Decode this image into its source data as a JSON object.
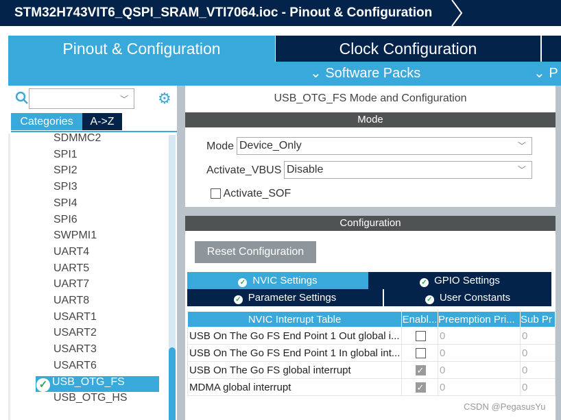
{
  "window": {
    "title": "STM32H743VIT6_QSPI_SRAM_VTI7064.ioc - Pinout & Configuration"
  },
  "tabs": [
    {
      "label": "Pinout & Configuration",
      "active": true
    },
    {
      "label": "Clock Configuration",
      "active": false
    }
  ],
  "subbar": {
    "software_packs": "Software Packs",
    "next": "P"
  },
  "sidebar": {
    "search_value": "",
    "tabs": [
      {
        "label": "Categories",
        "active": true
      },
      {
        "label": "A->Z"
      }
    ],
    "items": [
      "SDMMC2",
      "SPI1",
      "SPI2",
      "SPI3",
      "SPI4",
      "SPI6",
      "SWPMI1",
      "UART4",
      "UART5",
      "UART7",
      "UART8",
      "USART1",
      "USART2",
      "USART3",
      "USART6",
      "USB_OTG_FS",
      "USB_OTG_HS"
    ],
    "selected": "USB_OTG_FS"
  },
  "main": {
    "title": "USB_OTG_FS Mode and Configuration",
    "mode": {
      "header": "Mode",
      "mode_label": "Mode",
      "mode_value": "Device_Only",
      "vbus_label": "Activate_VBUS",
      "vbus_value": "Disable",
      "sof_label": "Activate_SOF",
      "sof_checked": false
    },
    "config": {
      "header": "Configuration",
      "reset": "Reset Configuration",
      "tabs": [
        "NVIC Settings",
        "GPIO Settings",
        "Parameter Settings",
        "User Constants"
      ],
      "table": {
        "columns": [
          "NVIC Interrupt Table",
          "Enabl...",
          "Preemption Pri...",
          "Sub Pr"
        ],
        "rows": [
          {
            "name": "USB On The Go FS End Point 1 Out global i...",
            "enabled": false,
            "pre": "0",
            "sub": "0"
          },
          {
            "name": "USB On The Go FS End Point 1 In global int...",
            "enabled": false,
            "pre": "0",
            "sub": "0"
          },
          {
            "name": "USB On The Go FS global interrupt",
            "enabled": true,
            "pre": "0",
            "sub": "0"
          },
          {
            "name": "MDMA global interrupt",
            "enabled": true,
            "pre": "0",
            "sub": "0"
          }
        ]
      }
    }
  },
  "watermark": "CSDN @PegasusYu",
  "colors": {
    "navy": "#03234b",
    "accent": "#39a9db",
    "header_gray": "#505354",
    "check_green": "#2fa65a"
  }
}
